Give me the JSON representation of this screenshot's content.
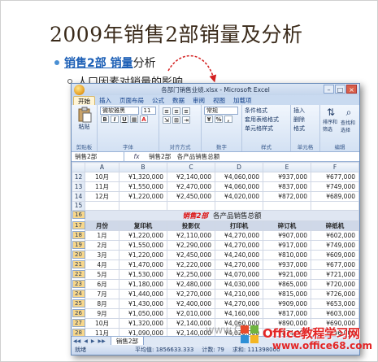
{
  "slide": {
    "title": "2009年销售2部销量及分析",
    "bullet_link": "销售2部 销量",
    "bullet_rest": "分析",
    "sub_bullet": "人口因素对销量的影响"
  },
  "excel": {
    "window_title": "各部门销售业绩.xlsx - Microsoft Excel",
    "tabs": [
      "开始",
      "插入",
      "页面布局",
      "公式",
      "数据",
      "审阅",
      "视图",
      "加载项"
    ],
    "ribbon": {
      "paste": "粘贴",
      "font_name": "微软雅黑",
      "font_size": "11",
      "number_format": "常规",
      "cond_format": "条件格式",
      "table_format": "套用表格格式",
      "cell_style": "单元格样式",
      "insert": "插入",
      "delete": "删除",
      "format": "格式",
      "sort_filter": "排序和筛选",
      "find_select": "查找和选择",
      "groups": [
        "剪贴板",
        "字体",
        "对齐方式",
        "数字",
        "样式",
        "单元格",
        "编辑"
      ]
    },
    "name_box": "销售2部",
    "fx": "fx",
    "formula": "销售2部　各产品销售总额",
    "columns": [
      "A",
      "B",
      "C",
      "D",
      "E",
      "F",
      "G"
    ],
    "top_rows": [
      {
        "n": "12",
        "month": "10月",
        "v": [
          "¥1,320,000",
          "¥2,140,000",
          "¥4,060,000",
          "¥937,000",
          "¥677,000"
        ]
      },
      {
        "n": "13",
        "month": "11月",
        "v": [
          "¥1,550,000",
          "¥2,470,000",
          "¥4,060,000",
          "¥837,000",
          "¥749,000"
        ]
      },
      {
        "n": "14",
        "month": "12月",
        "v": [
          "¥1,220,000",
          "¥2,450,000",
          "¥4,020,000",
          "¥872,000",
          "¥689,000"
        ]
      }
    ],
    "blank_row": "15",
    "title_row": {
      "n": "16",
      "red": "销售2部",
      "rest": "各产品销售总额"
    },
    "header_row": {
      "n": "17",
      "cells": [
        "月份",
        "复印机",
        "投影仪",
        "打印机",
        "碎订机",
        "碎纸机"
      ]
    },
    "rows": [
      {
        "n": "18",
        "month": "1月",
        "v": [
          "¥1,220,000",
          "¥2,110,000",
          "¥4,270,000",
          "¥907,000",
          "¥602,000"
        ]
      },
      {
        "n": "19",
        "month": "2月",
        "v": [
          "¥1,550,000",
          "¥2,290,000",
          "¥4,270,000",
          "¥917,000",
          "¥749,000"
        ]
      },
      {
        "n": "20",
        "month": "3月",
        "v": [
          "¥1,220,000",
          "¥2,450,000",
          "¥4,240,000",
          "¥810,000",
          "¥609,000"
        ]
      },
      {
        "n": "21",
        "month": "4月",
        "v": [
          "¥1,470,000",
          "¥2,220,000",
          "¥4,270,000",
          "¥937,000",
          "¥677,000"
        ]
      },
      {
        "n": "22",
        "month": "5月",
        "v": [
          "¥1,530,000",
          "¥2,250,000",
          "¥4,070,000",
          "¥921,000",
          "¥721,000"
        ]
      },
      {
        "n": "23",
        "month": "6月",
        "v": [
          "¥1,180,000",
          "¥2,480,000",
          "¥4,030,000",
          "¥865,000",
          "¥720,000"
        ]
      },
      {
        "n": "24",
        "month": "7月",
        "v": [
          "¥1,440,000",
          "¥2,270,000",
          "¥4,210,000",
          "¥815,000",
          "¥726,000"
        ]
      },
      {
        "n": "25",
        "month": "8月",
        "v": [
          "¥1,430,000",
          "¥2,400,000",
          "¥4,270,000",
          "¥909,000",
          "¥653,000"
        ]
      },
      {
        "n": "26",
        "month": "9月",
        "v": [
          "¥1,050,000",
          "¥2,010,000",
          "¥4,160,000",
          "¥817,000",
          "¥603,000"
        ]
      },
      {
        "n": "27",
        "month": "10月",
        "v": [
          "¥1,320,000",
          "¥2,140,000",
          "¥4,060,000",
          "¥890,000",
          "¥690,000"
        ]
      },
      {
        "n": "28",
        "month": "11月",
        "v": [
          "¥1,090,000",
          "¥2,140,000",
          "¥4,020,000",
          "¥874,000",
          "¥696,000"
        ]
      },
      {
        "n": "29",
        "month": "12月",
        "v": [
          "¥1,210,000",
          "¥2,140,000",
          "¥4,110,000",
          "¥820,000",
          "¥696,000"
        ]
      }
    ],
    "sheet_tab": "销售2部",
    "status": {
      "ready": "就绪",
      "avg": "平均值: 1856633.333",
      "count": "计数: 79",
      "sum": "求和: 111398000"
    }
  },
  "watermark": {
    "main": "Office教程学习网",
    "url": "www.office68.com",
    "faint": "www.Offic"
  },
  "colors": {
    "accent_red": "#e32626",
    "link_blue": "#1c5fb6",
    "excel_blue": "#dfe8f5"
  }
}
